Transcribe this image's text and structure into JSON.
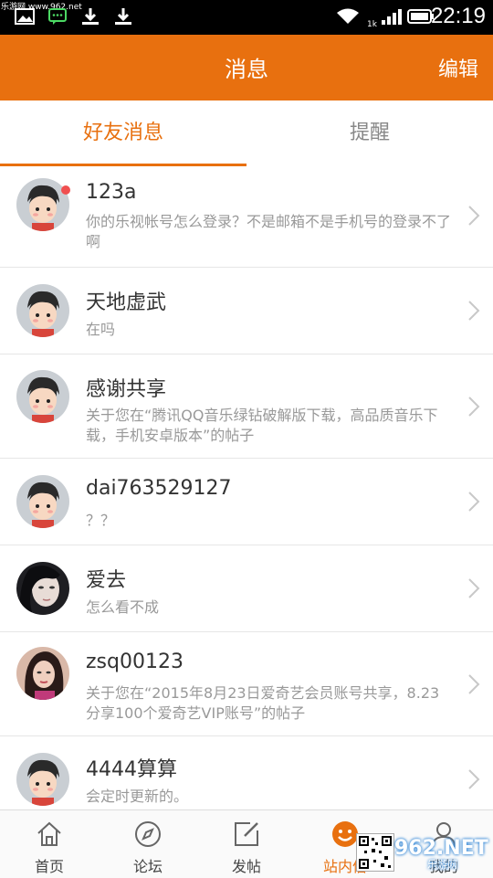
{
  "status_bar": {
    "watermark": "乐游网 www.962.net",
    "network_label": "1k",
    "time": "22:19"
  },
  "header": {
    "title": "消息",
    "edit_label": "编辑",
    "color": "#e8700f"
  },
  "tabs": [
    {
      "label": "好友消息",
      "active": true
    },
    {
      "label": "提醒",
      "active": false
    }
  ],
  "messages": [
    {
      "name": "123a",
      "preview": "你的乐视帐号怎么登录？不是邮箱不是手机号的登录不了啊",
      "avatar": "cartoon-boy",
      "unread": true
    },
    {
      "name": "天地虚武",
      "preview": "在吗",
      "avatar": "cartoon-boy",
      "unread": false
    },
    {
      "name": "感谢共享",
      "preview": "关于您在“腾讯QQ音乐绿钻破解版下载，高品质音乐下载，手机安卓版本”的帖子",
      "avatar": "cartoon-boy",
      "unread": false
    },
    {
      "name": "dai763529127",
      "preview": "？？",
      "avatar": "cartoon-boy",
      "unread": false
    },
    {
      "name": "爱去",
      "preview": "怎么看不成",
      "avatar": "photo-face",
      "unread": false
    },
    {
      "name": "zsq00123",
      "preview": "关于您在“2015年8月23日爱奇艺会员账号共享，8.23分享100个爱奇艺VIP账号”的帖子",
      "avatar": "photo-girl",
      "unread": false
    },
    {
      "name": "4444算算",
      "preview": "会定时更新的。",
      "avatar": "cartoon-boy",
      "unread": false
    }
  ],
  "bottom_nav": [
    {
      "label": "首页",
      "icon": "home-icon",
      "active": false
    },
    {
      "label": "论坛",
      "icon": "compass-icon",
      "active": false
    },
    {
      "label": "发帖",
      "icon": "compose-icon",
      "active": false
    },
    {
      "label": "站内信",
      "icon": "smile-icon",
      "active": true
    },
    {
      "label": "我的",
      "icon": "person-icon",
      "active": false
    }
  ],
  "overlay_watermark": {
    "text": "962.NET",
    "sub": "乐游网"
  }
}
